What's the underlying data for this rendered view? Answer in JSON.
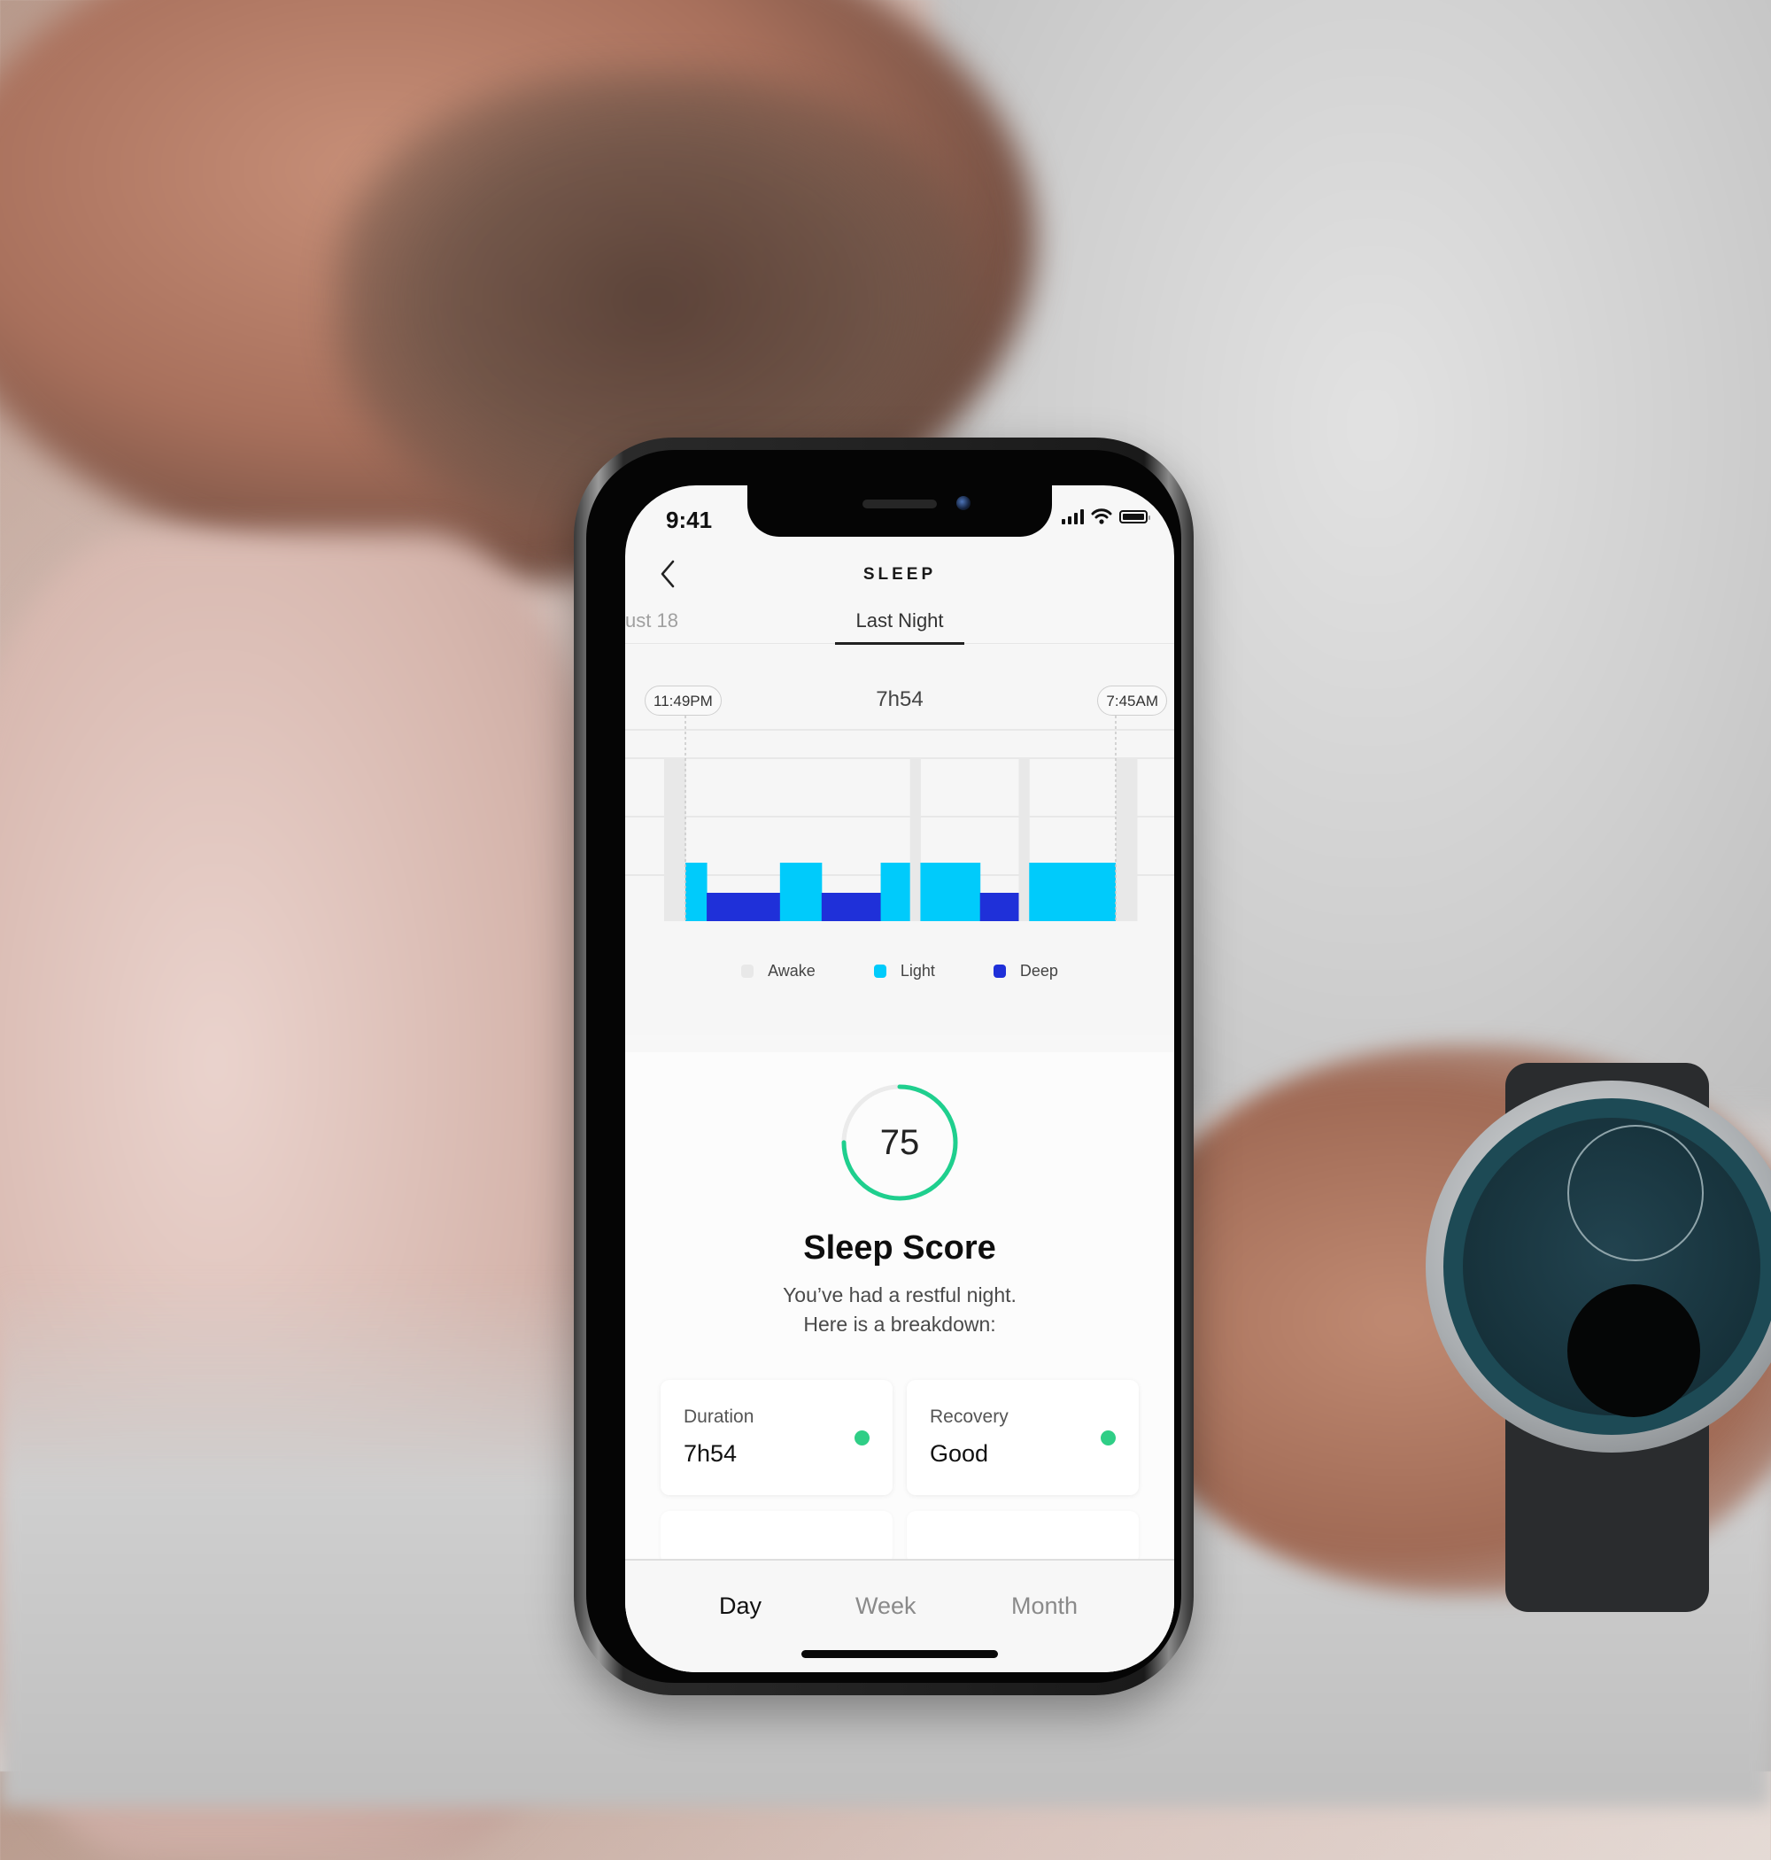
{
  "status_bar": {
    "time": "9:41",
    "icons": [
      "cellular-signal-icon",
      "wifi-icon",
      "battery-icon"
    ]
  },
  "nav": {
    "back_icon": "chevron-left-icon",
    "title": "SLEEP"
  },
  "date_tabs": {
    "previous": "ust 18",
    "active": "Last Night"
  },
  "sleep_chart": {
    "start_time": "11:49PM",
    "end_time": "7:45AM",
    "total_duration": "7h54"
  },
  "chart_data": {
    "type": "bar",
    "title": "7h54",
    "xlabel": "",
    "ylabel": "",
    "x_range_labels": [
      "11:49PM",
      "7:45AM"
    ],
    "levels": [
      "Deep",
      "Light",
      "Awake"
    ],
    "legend": [
      {
        "name": "Awake",
        "color": "#e8e8e8"
      },
      {
        "name": "Light",
        "color": "#00cbfb"
      },
      {
        "name": "Deep",
        "color": "#1f30d9"
      }
    ],
    "legend_position": "bottom",
    "grid": true,
    "segments": [
      {
        "stage": "Awake",
        "start": 0.0,
        "end": 0.045
      },
      {
        "stage": "Light",
        "start": 0.045,
        "end": 0.09
      },
      {
        "stage": "Deep",
        "start": 0.09,
        "end": 0.245
      },
      {
        "stage": "Light",
        "start": 0.245,
        "end": 0.333
      },
      {
        "stage": "Deep",
        "start": 0.333,
        "end": 0.458
      },
      {
        "stage": "Light",
        "start": 0.458,
        "end": 0.52
      },
      {
        "stage": "Awake",
        "start": 0.52,
        "end": 0.542
      },
      {
        "stage": "Light",
        "start": 0.542,
        "end": 0.668
      },
      {
        "stage": "Deep",
        "start": 0.668,
        "end": 0.75
      },
      {
        "stage": "Awake",
        "start": 0.75,
        "end": 0.772
      },
      {
        "stage": "Light",
        "start": 0.772,
        "end": 0.955
      },
      {
        "stage": "Awake",
        "start": 0.955,
        "end": 1.0
      }
    ]
  },
  "score": {
    "value": "75",
    "fraction": 0.75,
    "title": "Sleep Score",
    "description_line1": "You’ve had a restful night.",
    "description_line2": "Here is a breakdown:",
    "ring_color": "#1fcf8e"
  },
  "metrics": [
    {
      "label": "Duration",
      "value": "7h54",
      "status_color": "#2fce86"
    },
    {
      "label": "Recovery",
      "value": "Good",
      "status_color": "#2fce86"
    }
  ],
  "period_tabs": [
    {
      "label": "Day",
      "active": true
    },
    {
      "label": "Week",
      "active": false
    },
    {
      "label": "Month",
      "active": false
    }
  ]
}
